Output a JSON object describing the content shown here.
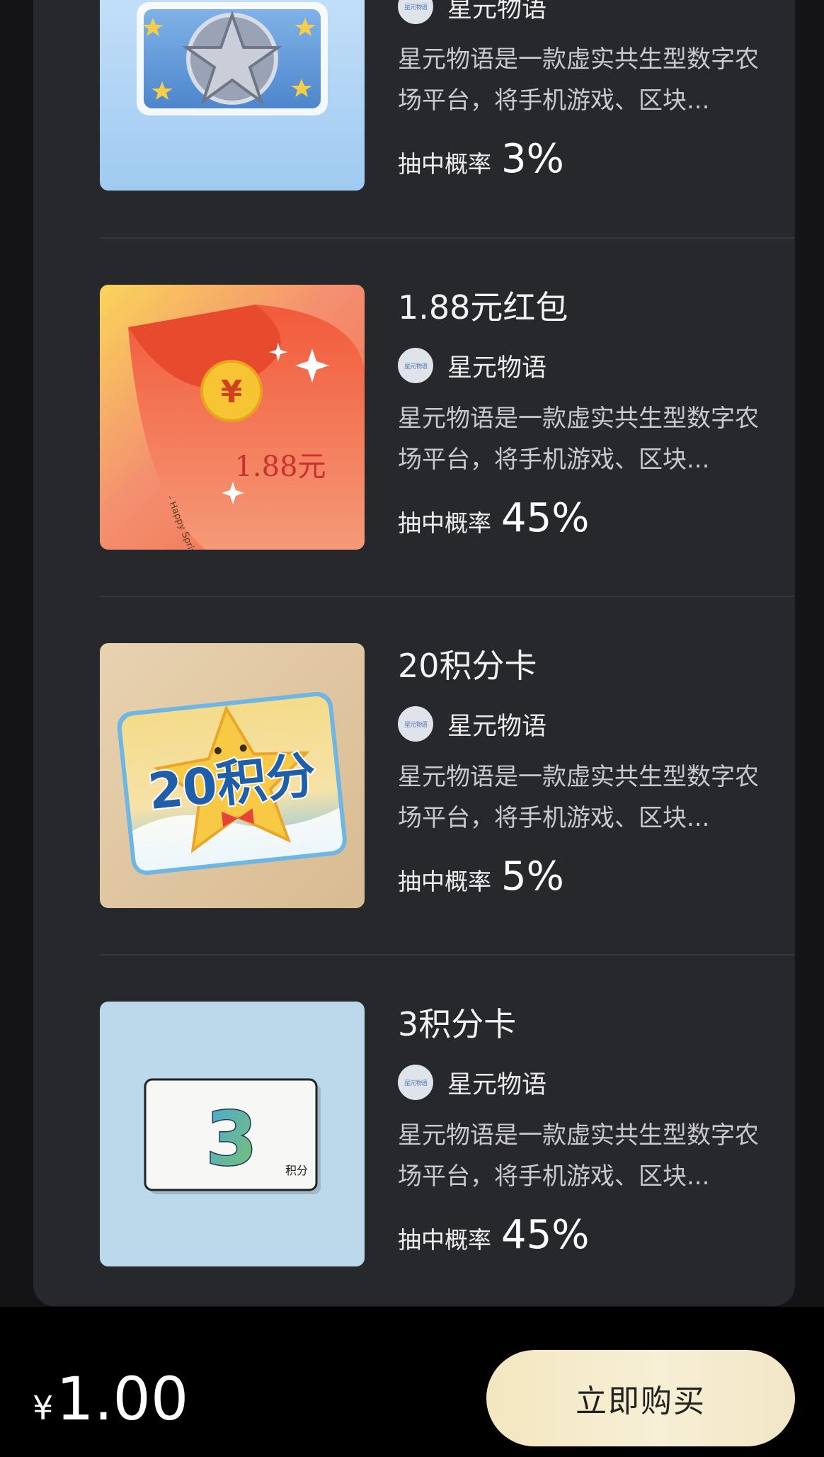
{
  "prizes": [
    {
      "name": "",
      "brand": "星元物语",
      "logo_text": "星元物语",
      "description": "星元物语是一款虚实共生型数字农场平台，将手机游戏、区块...",
      "odds_label": "抽中概率",
      "odds_value": "3%",
      "image_icon": "star-badge-coupon-icon"
    },
    {
      "name": "1.88元红包",
      "brand": "星元物语",
      "logo_text": "星元物语",
      "description": "星元物语是一款虚实共生型数字农场平台，将手机游戏、区块...",
      "odds_label": "抽中概率",
      "odds_value": "45%",
      "image_icon": "red-envelope-icon",
      "image_text": "1.88元",
      "image_caption": "- Happy Spring Festival -"
    },
    {
      "name": "20积分卡",
      "brand": "星元物语",
      "logo_text": "星元物语",
      "description": "星元物语是一款虚实共生型数字农场平台，将手机游戏、区块...",
      "odds_label": "抽中概率",
      "odds_value": "5%",
      "image_icon": "star-points-card-icon",
      "image_text": "20积分"
    },
    {
      "name": "3积分卡",
      "brand": "星元物语",
      "logo_text": "星元物语",
      "description": "星元物语是一款虚实共生型数字农场平台，将手机游戏、区块...",
      "odds_label": "抽中概率",
      "odds_value": "45%",
      "image_icon": "points-card-icon",
      "image_text": "3",
      "image_subtext": "积分"
    }
  ],
  "footer": {
    "currency": "¥",
    "price": "1.00",
    "buy_label": "立即购买"
  },
  "colors": {
    "background": "#141416",
    "card": "#27282c",
    "footer": "#000000",
    "buy_button": "#f4eacb"
  }
}
